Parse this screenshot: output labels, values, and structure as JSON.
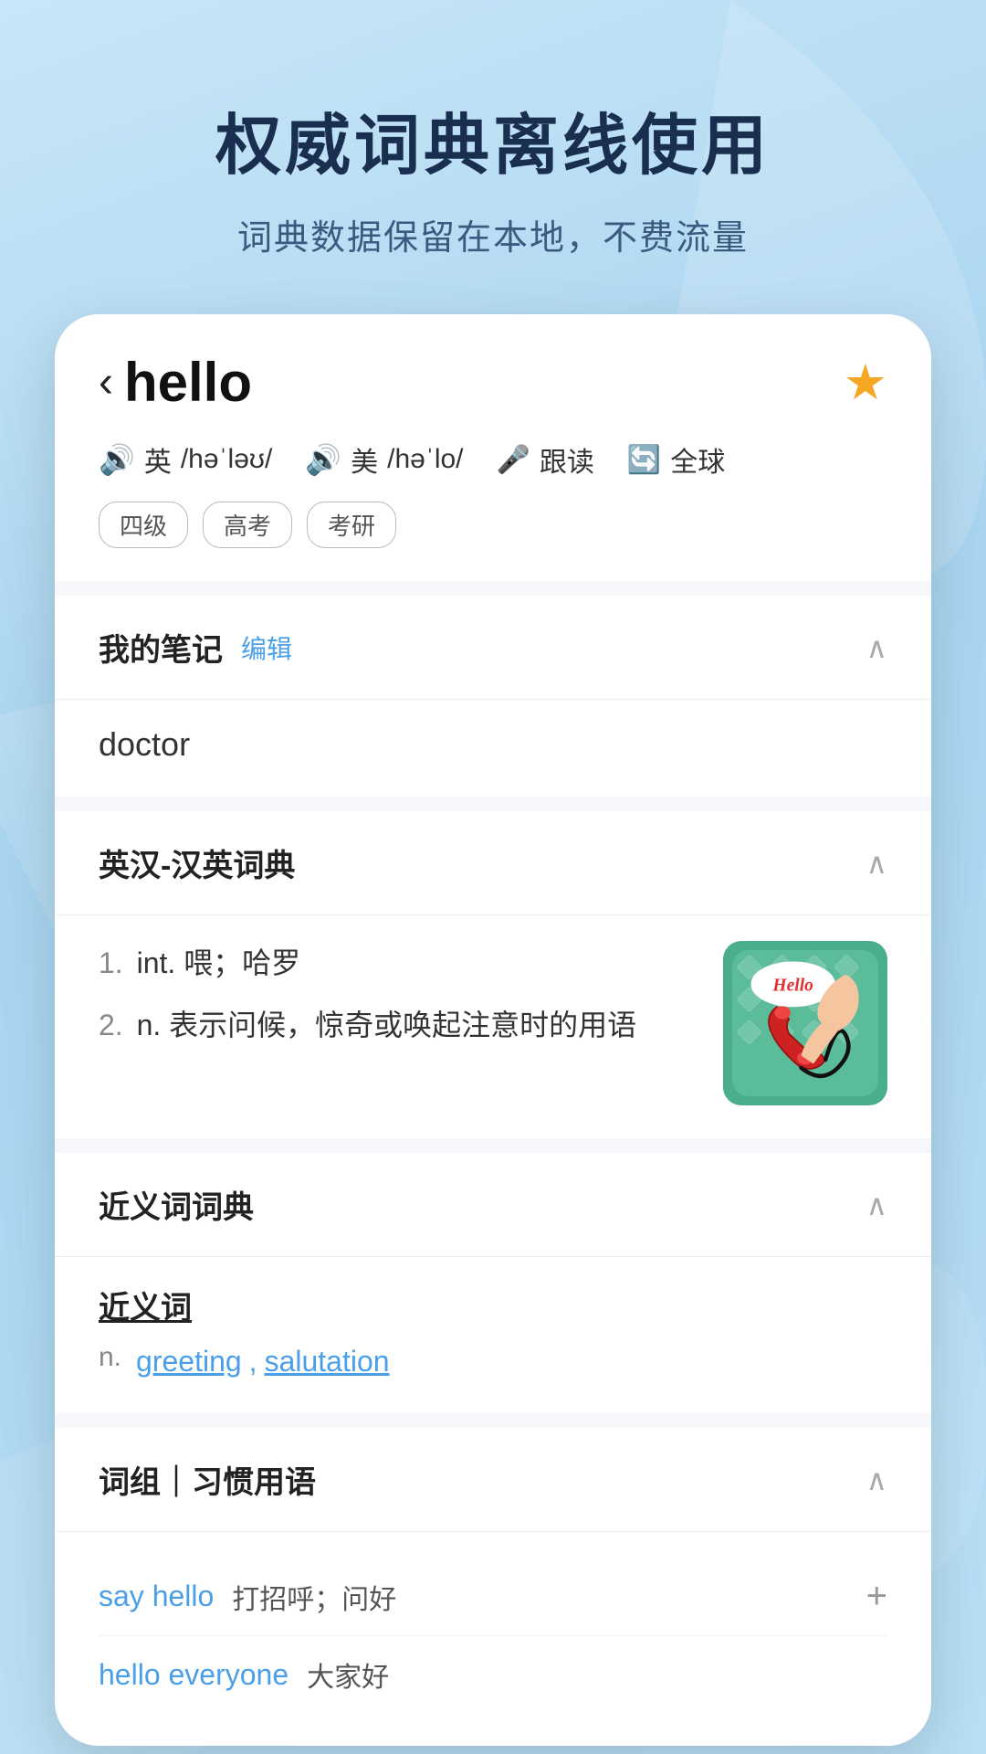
{
  "background": {
    "gradient_start": "#c8e6f7",
    "gradient_end": "#a8d4f0"
  },
  "top_section": {
    "main_title": "权威词典离线使用",
    "sub_title": "词典数据保留在本地，不费流量"
  },
  "card": {
    "header": {
      "back_label": "‹",
      "word": "hello",
      "star": "★",
      "phonetics": [
        {
          "icon": "🔊",
          "lang": "英",
          "text": "/həˈləʊ/"
        },
        {
          "icon": "🔊",
          "lang": "美",
          "text": "/həˈlo/"
        }
      ],
      "actions": [
        {
          "icon": "🎤",
          "label": "跟读"
        },
        {
          "icon": "🔄",
          "label": "全球"
        }
      ],
      "tags": [
        "四级",
        "高考",
        "考研"
      ]
    },
    "notes_section": {
      "title": "我的笔记",
      "edit_label": "编辑",
      "content": "doctor",
      "expanded": true
    },
    "dictionary_section": {
      "title": "英汉-汉英词典",
      "expanded": true,
      "definitions": [
        {
          "number": "1.",
          "pos": "int.",
          "text": "喂；哈罗"
        },
        {
          "number": "2.",
          "pos": "n.",
          "text": "表示问候，惊奇或唤起注意时的用语"
        }
      ],
      "image_label": "Hello"
    },
    "synonyms_section": {
      "title": "近义词词典",
      "expanded": true,
      "synonyms_heading": "近义词",
      "pos": "n.",
      "words": [
        "greeting",
        "salutation"
      ]
    },
    "phrases_section": {
      "title": "词组｜习惯用语",
      "expanded": true,
      "phrases": [
        {
          "en": "say hello",
          "zh": "打招呼；问好"
        },
        {
          "en": "hello everyone",
          "zh": "大家好"
        }
      ]
    }
  }
}
